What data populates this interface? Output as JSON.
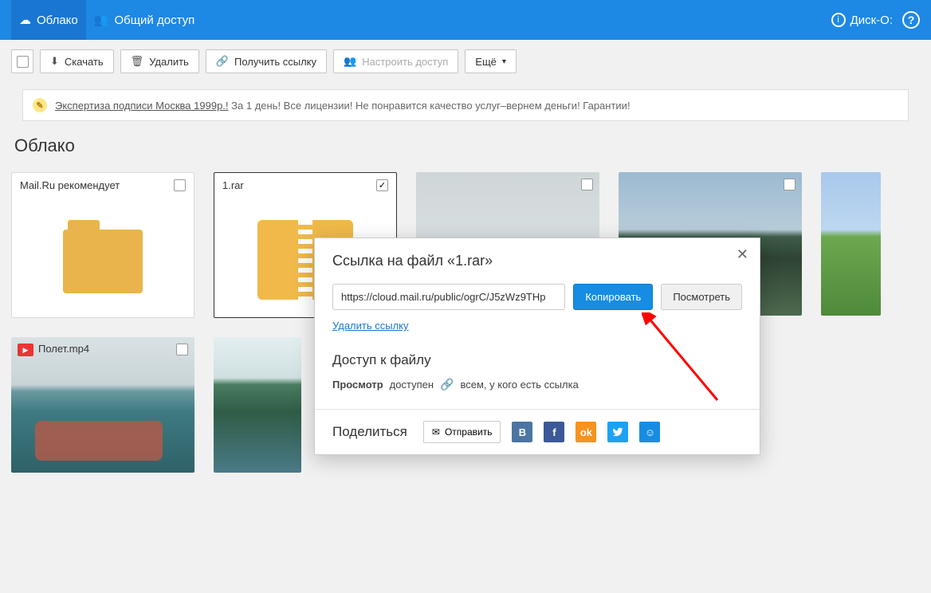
{
  "topbar": {
    "cloud": "Облако",
    "shared": "Общий доступ",
    "disk_o": "Диск-О:",
    "help": "?"
  },
  "toolbar": {
    "download": "Скачать",
    "delete": "Удалить",
    "get_link": "Получить ссылку",
    "configure_access": "Настроить доступ",
    "more": "Ещё"
  },
  "ad": {
    "link": "Экспертиза подписи Москва 1999р.!",
    "text": "За 1 день! Все лицензии! Не понравится качество услуг–вернем деньги! Гарантии!"
  },
  "breadcrumb": "Облако",
  "tiles": [
    {
      "name": "Mail.Ru рекомендует",
      "type": "folder",
      "checked": false
    },
    {
      "name": "1.rar",
      "type": "archive",
      "checked": true
    },
    {
      "name": "",
      "type": "photo",
      "style": "sky1"
    },
    {
      "name": "",
      "type": "photo",
      "style": "sky2"
    },
    {
      "name": "",
      "type": "photo-strip",
      "style": "sky3"
    },
    {
      "name": "Полет.mp4",
      "type": "video",
      "style": "sea"
    },
    {
      "name": "",
      "type": "photo",
      "style": "lake"
    }
  ],
  "modal": {
    "title": "Ссылка на файл «1.rar»",
    "link_value": "https://cloud.mail.ru/public/ogrC/J5zWz9THp",
    "copy": "Копировать",
    "view": "Посмотреть",
    "delete_link": "Удалить ссылку",
    "access_heading": "Доступ к файлу",
    "access_state_label": "Просмотр",
    "access_state_value": "доступен",
    "access_who": "всем, у кого есть ссылка",
    "share_heading": "Поделиться",
    "send": "Отправить",
    "close": "✕"
  }
}
